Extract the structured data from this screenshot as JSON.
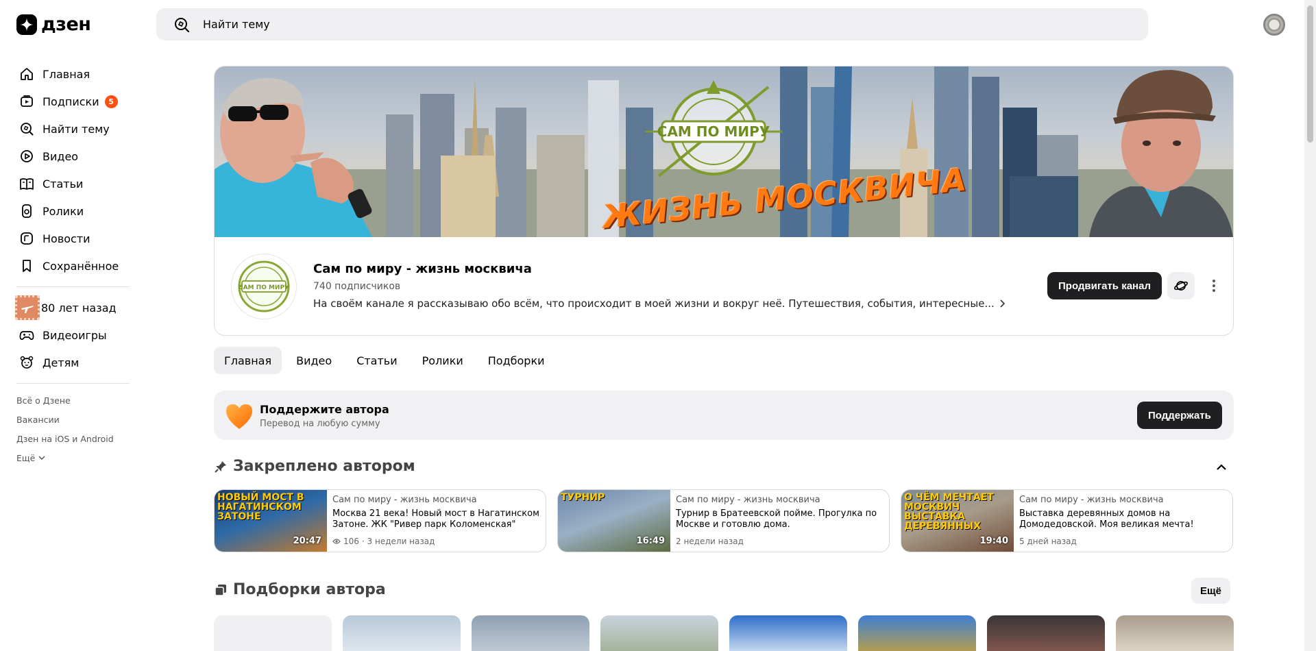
{
  "brand": {
    "logo_text": "дзен"
  },
  "search": {
    "placeholder": "Найти тему"
  },
  "sidebar": {
    "items": [
      {
        "label": "Главная",
        "icon": "home-icon"
      },
      {
        "label": "Подписки",
        "icon": "subscriptions-icon",
        "badge": "5"
      },
      {
        "label": "Найти тему",
        "icon": "search-icon"
      },
      {
        "label": "Видео",
        "icon": "video-icon"
      },
      {
        "label": "Статьи",
        "icon": "articles-icon"
      },
      {
        "label": "Ролики",
        "icon": "shorts-icon"
      },
      {
        "label": "Новости",
        "icon": "news-icon"
      },
      {
        "label": "Сохранённое",
        "icon": "bookmark-icon"
      }
    ],
    "extra_items": [
      {
        "label": "80 лет назад",
        "icon": "stamp-icon"
      },
      {
        "label": "Видеоигры",
        "icon": "gamepad-icon"
      },
      {
        "label": "Детям",
        "icon": "kids-icon"
      }
    ],
    "footer_links": [
      "Всё о Дзене",
      "Вакансии",
      "Дзен на iOS и Android",
      "Ещё"
    ]
  },
  "channel": {
    "banner_title": "ЖИЗНЬ МОСКВИЧА",
    "logo_text": "САМ ПО МИРУ",
    "name": "Сам по миру - жизнь москвича",
    "subscribers": "740 подписчиков",
    "description": "На своём канале я рассказываю обо всём, что происходит в моей жизни и вокруг неё. Путешествия, события, интересные...",
    "promote_label": "Продвигать канал"
  },
  "tabs": [
    "Главная",
    "Видео",
    "Статьи",
    "Ролики",
    "Подборки"
  ],
  "support": {
    "title": "Поддержите автора",
    "subtitle": "Перевод на любую сумму",
    "button": "Поддержать"
  },
  "pinned": {
    "title": "Закреплено автором",
    "cards": [
      {
        "thumb_text": "НОВЫЙ МОСТ В НАГАТИНСКОМ ЗАТОНЕ",
        "duration": "20:47",
        "channel": "Сам по миру - жизнь москвича",
        "title": "Москва 21 века! Новый мост в Нагатинском Затоне. ЖК \"Ривер парк Коломенская\"",
        "views": "106",
        "date": "· 3 недели назад"
      },
      {
        "thumb_text": "ТУРНИР",
        "duration": "16:49",
        "channel": "Сам по миру - жизнь москвича",
        "title": "Турнир в Братеевской пойме. Прогулка по Москве и готовлю дома.",
        "views": "",
        "date": "2 недели назад"
      },
      {
        "thumb_text": "О ЧЁМ МЕЧТАЕТ МОСКВИЧ ВЫСТАВКА ДЕРЕВЯННЫХ",
        "duration": "19:40",
        "channel": "Сам по миру - жизнь москвича",
        "title": "Выставка деревянных домов на Домодедовской. Моя великая мечта!",
        "views": "",
        "date": "5 дней назад"
      }
    ]
  },
  "collections": {
    "title": "Подборки автора",
    "more_label": "Ещё"
  },
  "colors": {
    "accent": "#ff4f12",
    "dark_button": "#1f1f21",
    "light_bg": "#f0f0f2"
  }
}
